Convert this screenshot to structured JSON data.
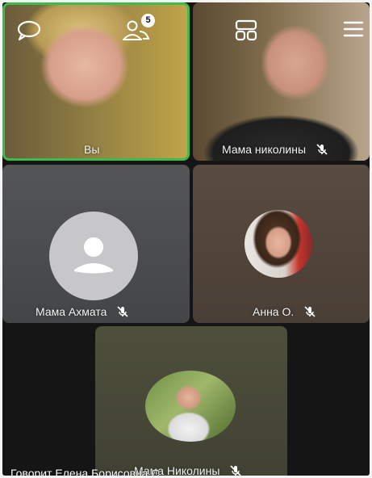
{
  "top_bar": {
    "participants_count": "5",
    "icons": [
      "chat-bubble-icon",
      "participants-icon",
      "layout-grid-icon",
      "menu-icon"
    ]
  },
  "participants": [
    {
      "name": "Вы",
      "mic_muted": false,
      "active_speaker_border": true
    },
    {
      "name": "Мама николины",
      "mic_muted": true
    },
    {
      "name": "Мама Ахмата",
      "mic_muted": true,
      "avatar": "default-user-icon"
    },
    {
      "name": "Анна О.",
      "mic_muted": true
    },
    {
      "name": "Мама Николины",
      "mic_muted": true
    }
  ],
  "status": {
    "speaking_text": "Говорит Елена Борисовна С."
  },
  "colors": {
    "active_border": "#3bbd4d",
    "background": "#151515"
  }
}
